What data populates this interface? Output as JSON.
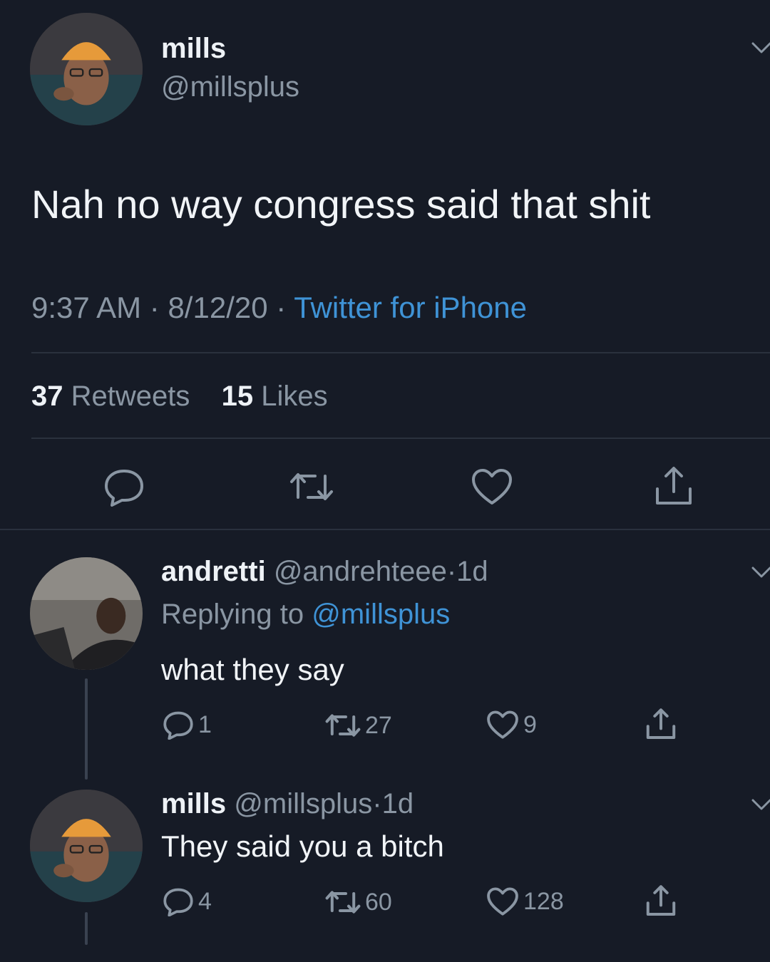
{
  "main_tweet": {
    "display_name": "mills",
    "handle": "@millsplus",
    "text": "Nah no way congress said that shit",
    "time": "9:37 AM",
    "date": "8/12/20",
    "source": "Twitter for iPhone",
    "sep1": "·",
    "sep2": "·",
    "retweets_count": "37",
    "retweets_label": "Retweets",
    "likes_count": "15",
    "likes_label": "Likes"
  },
  "reply1": {
    "display_name": "andretti",
    "handle": "@andrehteee",
    "sep": "·",
    "age": "1d",
    "replying_prefix": "Replying to",
    "replying_to": "@millsplus",
    "text": "what they say",
    "reply_count": "1",
    "retweet_count": "27",
    "like_count": "9"
  },
  "reply2": {
    "display_name": "mills",
    "handle": "@millsplus",
    "sep": "·",
    "age": "1d",
    "text": "They said you a bitch",
    "reply_count": "4",
    "retweet_count": "60",
    "like_count": "128"
  },
  "icons": {
    "reply": "reply-icon",
    "retweet": "retweet-icon",
    "like": "heart-icon",
    "share": "share-icon",
    "menu": "chevron-down-icon"
  },
  "colors": {
    "background": "#161b26",
    "link": "#3f93d6",
    "muted": "#8a96a3",
    "text": "#e8ecf0"
  }
}
